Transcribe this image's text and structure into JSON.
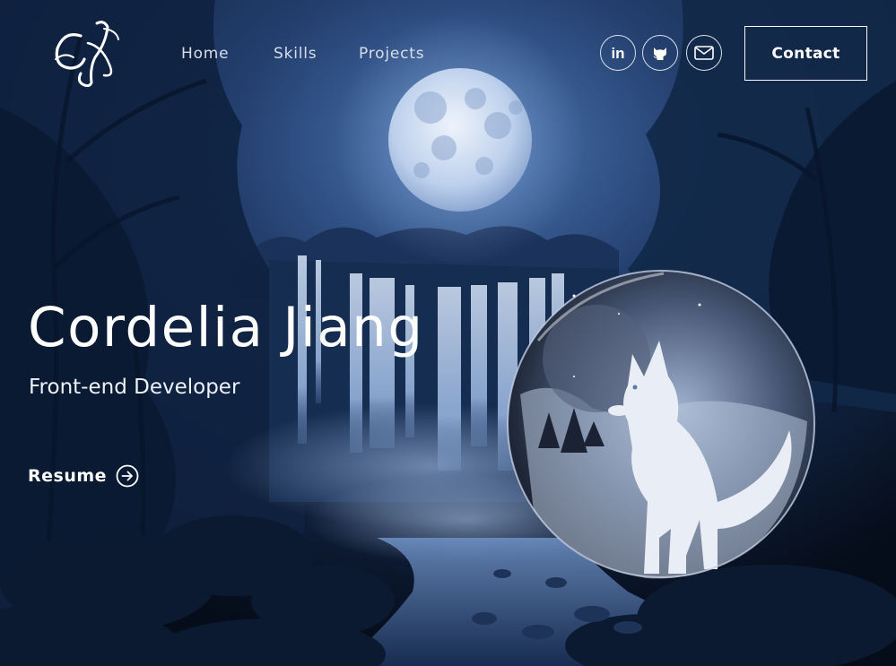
{
  "brand": {
    "logo_text": "CJ"
  },
  "nav": {
    "items": [
      "Home",
      "Skills",
      "Projects"
    ]
  },
  "social": [
    "linkedin-icon",
    "github-icon",
    "mail-icon"
  ],
  "social_labels": {
    "linkedin": "in"
  },
  "header": {
    "contact_label": "Contact"
  },
  "hero": {
    "name": "Cordelia Jiang",
    "role": "Front-end Developer",
    "resume_label": "Resume"
  },
  "colors": {
    "background": "#0a1528",
    "night_blue": "#27467a",
    "moon": "#c9d8ee",
    "text": "#ffffff"
  }
}
